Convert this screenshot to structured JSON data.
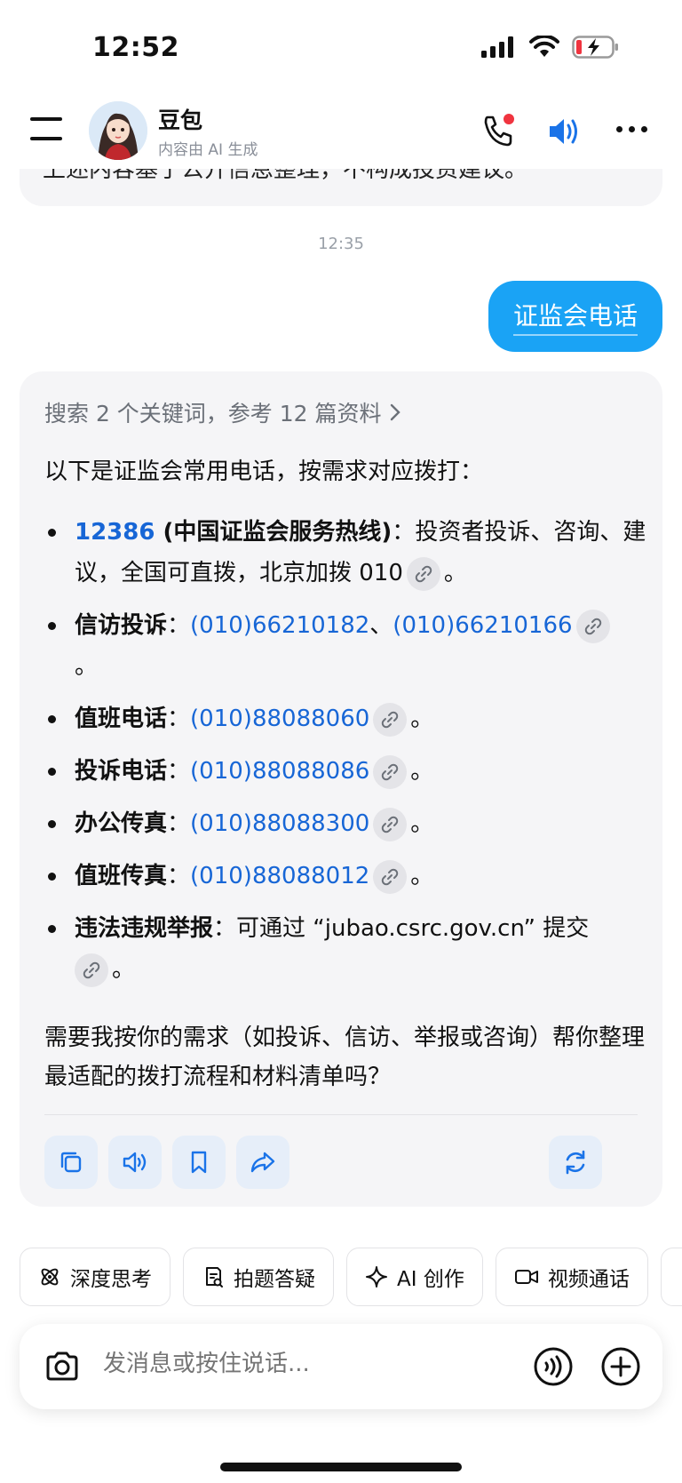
{
  "status_bar": {
    "time": "12:52"
  },
  "header": {
    "title": "豆包",
    "subtitle": "内容由 AI 生成",
    "icons": [
      "menu-icon",
      "phone-call-icon",
      "speaker-icon",
      "more-icon"
    ]
  },
  "previous_message": {
    "partial_text": "上述内容基于公开信息整理，不构成投资建议。"
  },
  "timestamp": "12:35",
  "user_message": "证监会电话",
  "answer": {
    "search_ref": "搜索 2 个关键词，参考 12 篇资料",
    "intro": "以下是证监会常用电话，按需求对应拨打：",
    "items": [
      {
        "number": "12386",
        "label": " (中国证监会服务热线)",
        "sep": "：",
        "desc": "投资者投诉、咨询、建议，全国可直拨，北京加拨 010",
        "end": "。"
      },
      {
        "label": "信访投诉",
        "sep": "：",
        "phone1": "(010)66210182",
        "joiner": "、",
        "phone2": "(010)66210166",
        "end": "。"
      },
      {
        "label": "值班电话",
        "sep": "：",
        "phone": "(010)88088060",
        "end": "。"
      },
      {
        "label": "投诉电话",
        "sep": "：",
        "phone": "(010)88088086",
        "end": "。"
      },
      {
        "label": "办公传真",
        "sep": "：",
        "phone": "(010)88088300",
        "end": "。"
      },
      {
        "label": "值班传真",
        "sep": "：",
        "phone": "(010)88088012",
        "end": "。"
      },
      {
        "label": "违法违规举报",
        "sep": "：",
        "desc": "可通过 “jubao.csrc.gov.cn” 提交",
        "end": "。"
      }
    ],
    "closing": "需要我按你的需求（如投诉、信访、举报或咨询）帮你整理最适配的拨打流程和材料清单吗？",
    "actions": [
      "copy-icon",
      "read-aloud-icon",
      "bookmark-icon",
      "share-icon",
      "regenerate-icon"
    ]
  },
  "chips": [
    {
      "label": "深度思考",
      "icon": "atom-icon"
    },
    {
      "label": "拍题答疑",
      "icon": "scan-question-icon"
    },
    {
      "label": "AI 创作",
      "icon": "sparkle-icon"
    },
    {
      "label": "视频通话",
      "icon": "video-icon"
    }
  ],
  "input": {
    "placeholder": "发消息或按住说话..."
  },
  "colors": {
    "accent": "#1aa3f5",
    "link": "#1766d6",
    "card_bg": "#f5f5f7",
    "badge_red": "#f0343f"
  }
}
